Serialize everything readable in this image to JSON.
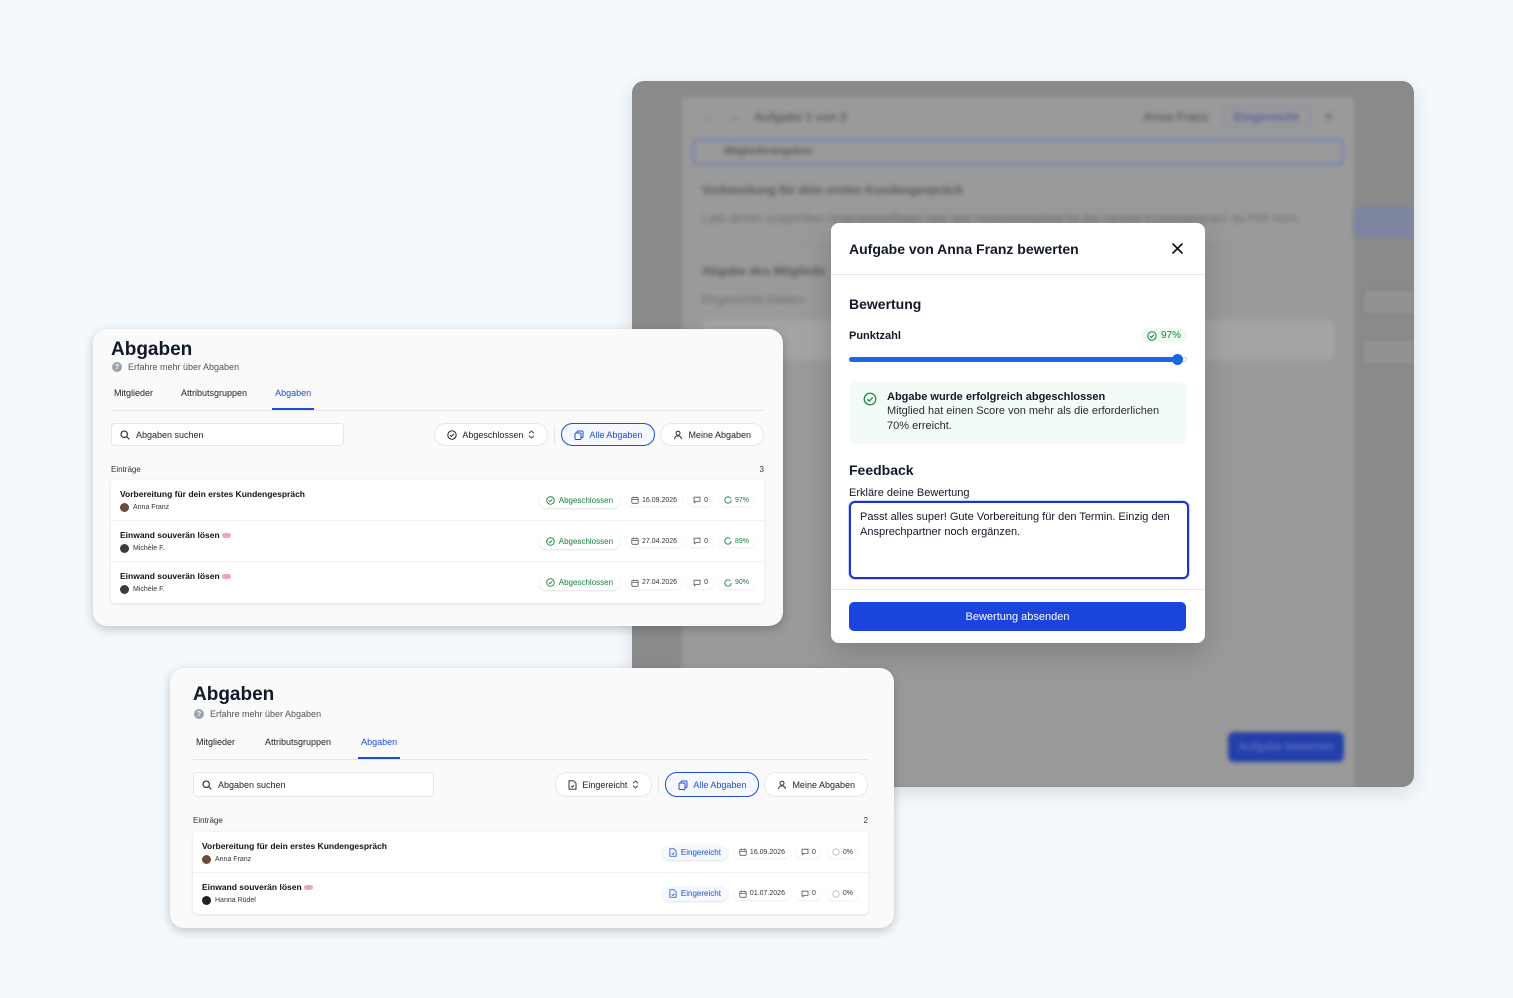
{
  "background_window": {
    "title": "Aufgabe 1 von 2",
    "user": "Anna Franz",
    "status": "Eingereicht",
    "input_label": "Mitgliederangaben",
    "section_title": "Vorbereitung für dein erstes Kundengespräch",
    "section_text": "Lade deinen ausgefüllten Gesprächsleitfaden oder dein Vorbereitungsblatt für das nächste Kundengespräch als PDF hoch.",
    "section2_title": "Abgabe des Mitglieds",
    "section2_sub": "Eingereichte Dateien",
    "submit_label": "Aufgabe bewerten"
  },
  "dialog": {
    "title": "Aufgabe von Anna Franz bewerten",
    "rating_heading": "Bewertung",
    "score_label": "Punktzahl",
    "score_value": "97%",
    "score_percent": 97,
    "success_title": "Abgabe wurde erfolgreich abgeschlossen",
    "success_text": "Mitglied hat einen Score von mehr als die erforderlichen 70% erreicht.",
    "feedback_heading": "Feedback",
    "feedback_label": "Erkläre deine Bewertung",
    "feedback_value": "Passt alles super! Gute Vorbereitung für den Termin. Einzig den Ansprechpartner noch ergänzen.",
    "submit_label": "Bewertung absenden"
  },
  "card1": {
    "title": "Abgaben",
    "learn_more": "Erfahre mehr über Abgaben",
    "tabs": [
      "Mitglieder",
      "Attributsgruppen",
      "Abgaben"
    ],
    "search_placeholder": "Abgaben suchen",
    "status_filter": "Abgeschlossen",
    "filter_all": "Alle Abgaben",
    "filter_mine": "Meine Abgaben",
    "entries_label": "Einträge",
    "entries_count": "3",
    "rows": [
      {
        "title": "Vorbereitung für dein erstes Kundengespräch",
        "user": "Anna Franz",
        "status": "Abgeschlossen",
        "date": "16.09.2026",
        "comments": "0",
        "score": "97%"
      },
      {
        "title": "Einwand souverän lösen",
        "user": "Michèle F.",
        "status": "Abgeschlossen",
        "date": "27.04.2026",
        "comments": "0",
        "score": "89%"
      },
      {
        "title": "Einwand souverän lösen",
        "user": "Michèle F.",
        "status": "Abgeschlossen",
        "date": "27.04.2026",
        "comments": "0",
        "score": "90%"
      }
    ]
  },
  "card2": {
    "title": "Abgaben",
    "learn_more": "Erfahre mehr über Abgaben",
    "tabs": [
      "Mitglieder",
      "Attributsgruppen",
      "Abgaben"
    ],
    "search_placeholder": "Abgaben suchen",
    "status_filter": "Eingereicht",
    "filter_all": "Alle Abgaben",
    "filter_mine": "Meine Abgaben",
    "entries_label": "Einträge",
    "entries_count": "2",
    "rows": [
      {
        "title": "Vorbereitung für dein erstes Kundengespräch",
        "user": "Anna Franz",
        "status": "Eingereicht",
        "date": "16.09.2026",
        "comments": "0",
        "score": "0%"
      },
      {
        "title": "Einwand souverän lösen",
        "user": "Hanna Rüdel",
        "status": "Eingereicht",
        "date": "01.07.2026",
        "comments": "0",
        "score": "0%"
      }
    ]
  },
  "colors": {
    "accent": "#1a44dd",
    "success": "#15803d",
    "background": "#f4f9fd"
  }
}
